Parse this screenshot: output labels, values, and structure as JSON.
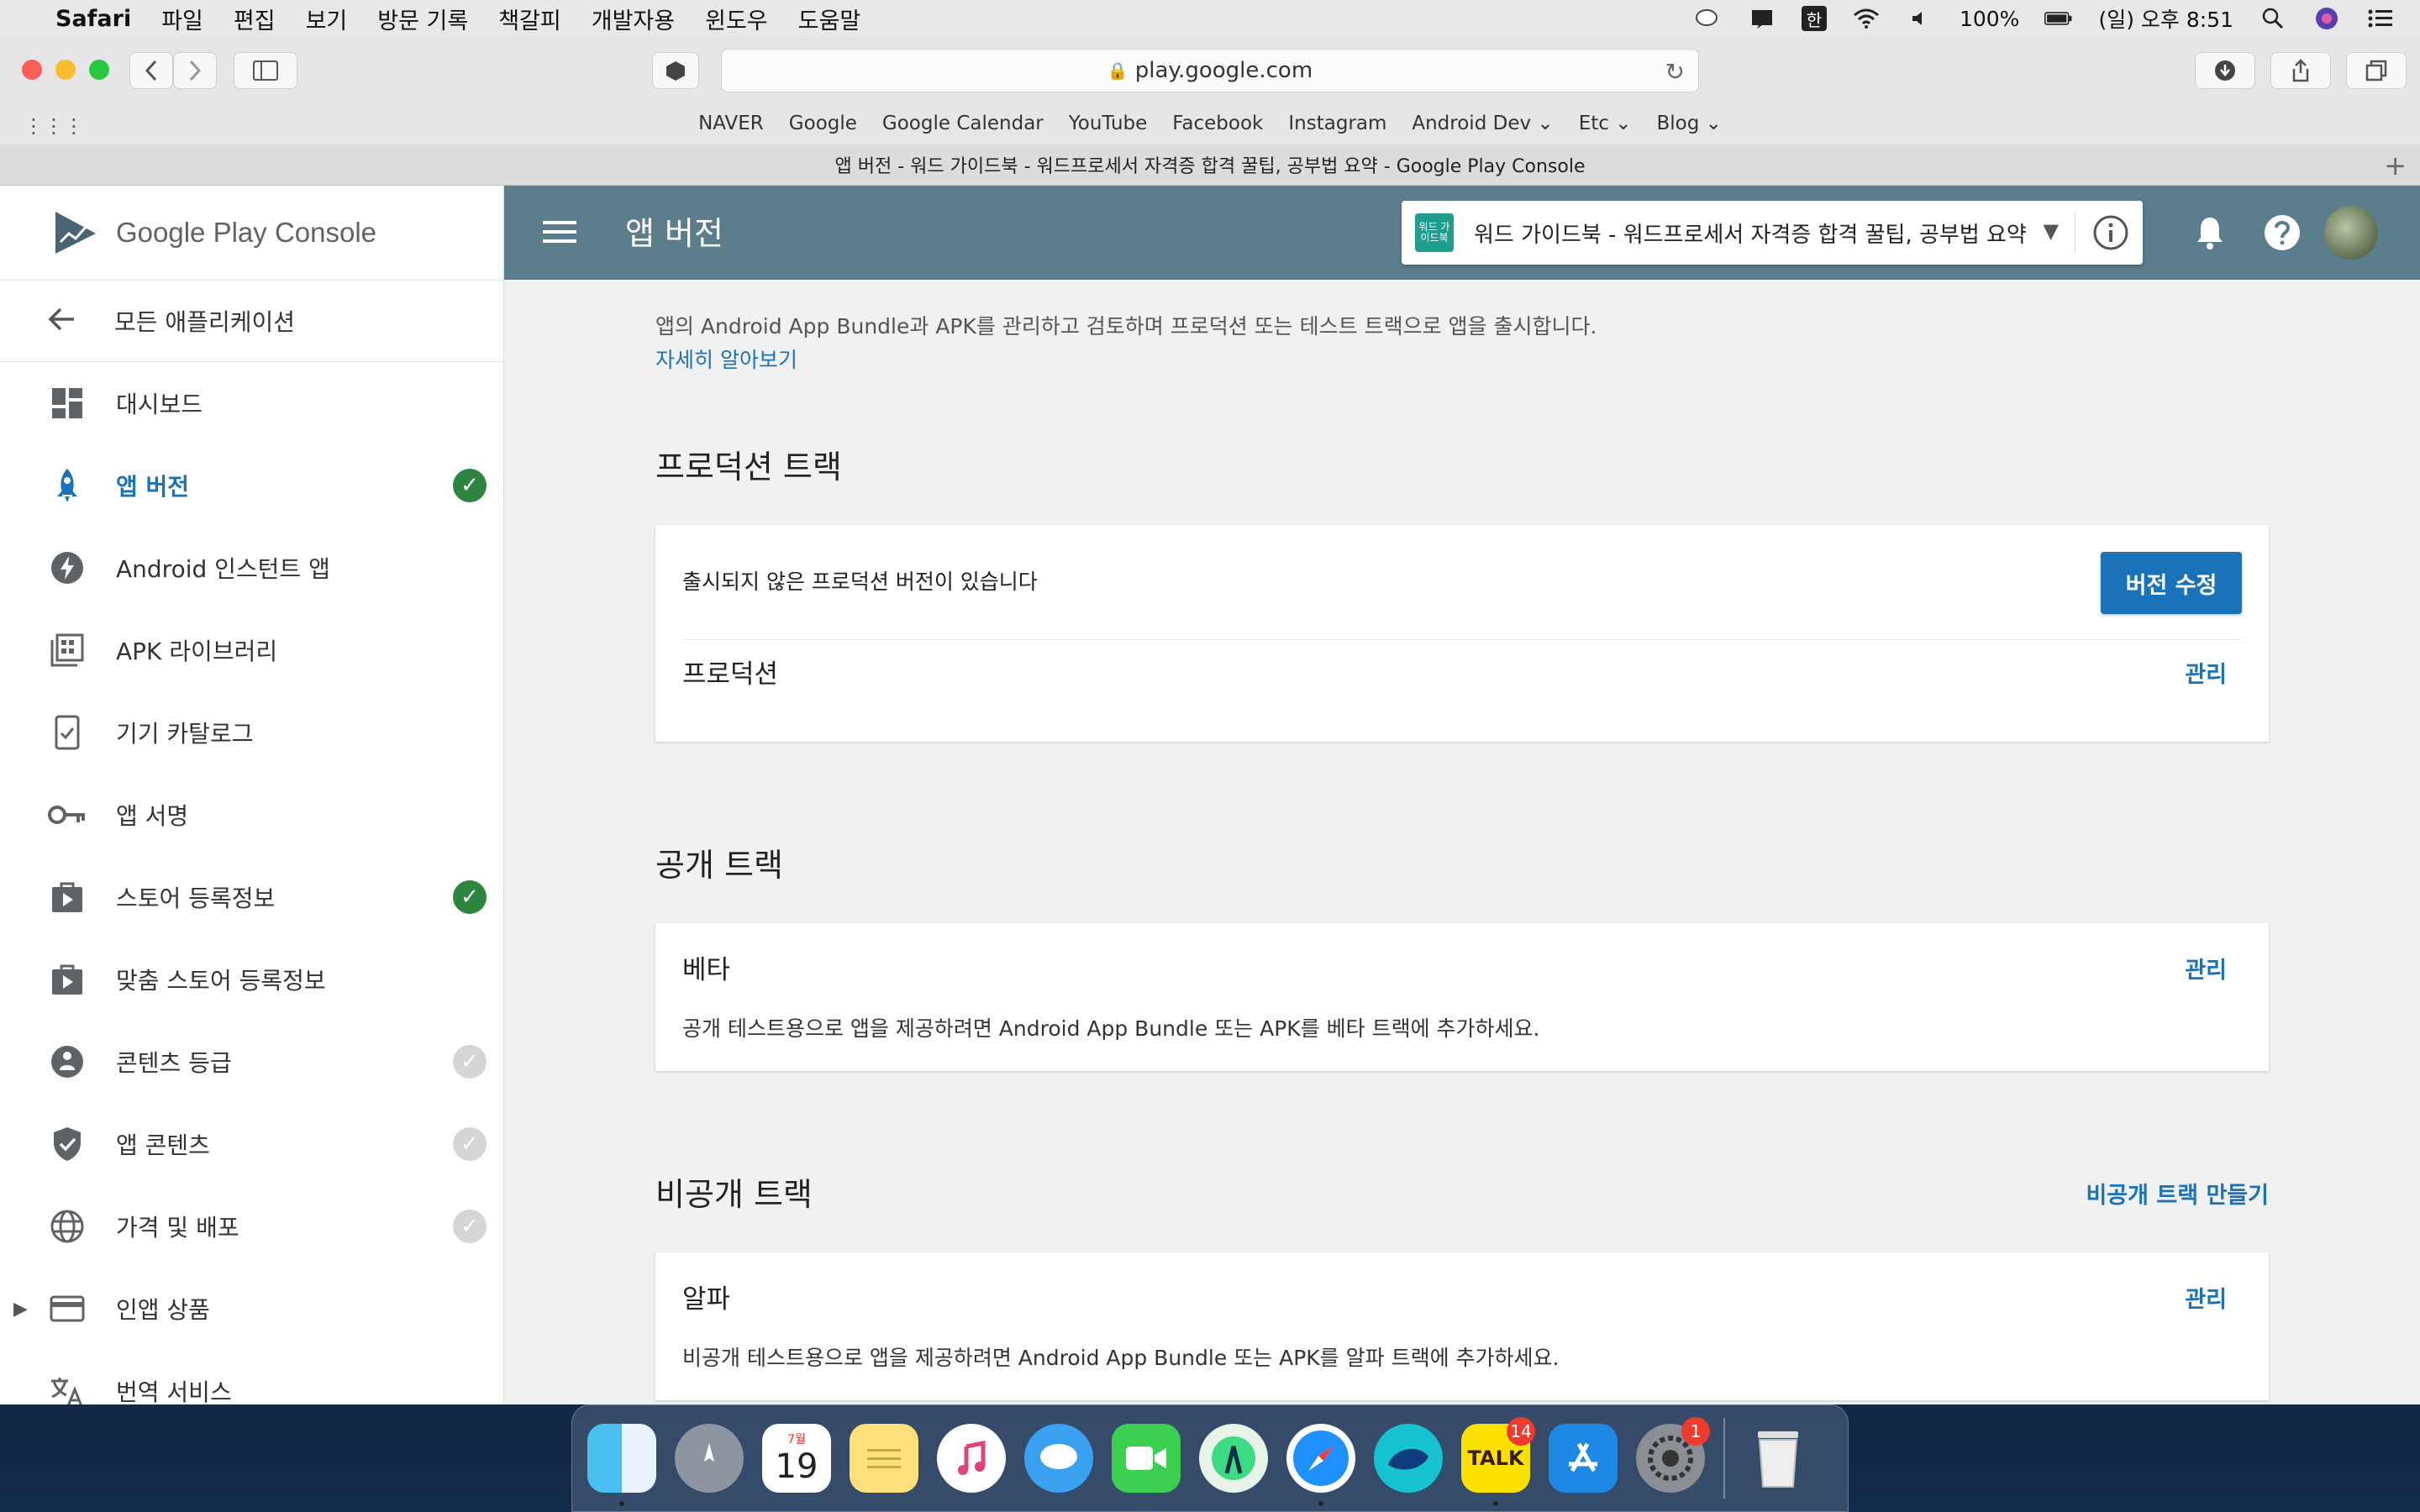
{
  "menubar": {
    "app": "Safari",
    "menus": [
      "파일",
      "편집",
      "보기",
      "방문 기록",
      "책갈피",
      "개발자용",
      "윈도우",
      "도움말"
    ],
    "battery": "100%",
    "clock": "(일) 오후 8:51",
    "input_method": "한"
  },
  "browser": {
    "url": "play.google.com",
    "favorites": [
      "NAVER",
      "Google",
      "Google Calendar",
      "YouTube",
      "Facebook",
      "Instagram",
      "Android Dev",
      "Etc",
      "Blog"
    ],
    "tab_title": "앱 버전 - 워드 가이드북 - 워드프로세서 자격증 합격 꿀팁, 공부법 요약 - Google Play Console"
  },
  "sidebar": {
    "logo_brand": "Google Play",
    "logo_suffix": "Console",
    "back_label": "모든 애플리케이션",
    "items": [
      {
        "label": "대시보드",
        "icon": "dashboard-icon",
        "status": "none"
      },
      {
        "label": "앱 버전",
        "icon": "rocket-icon",
        "status": "done"
      },
      {
        "label": "Android 인스턴트 앱",
        "icon": "bolt-icon",
        "status": "none"
      },
      {
        "label": "APK 라이브러리",
        "icon": "library-icon",
        "status": "none"
      },
      {
        "label": "기기 카탈로그",
        "icon": "device-icon",
        "status": "none"
      },
      {
        "label": "앱 서명",
        "icon": "key-icon",
        "status": "none"
      },
      {
        "label": "스토어 등록정보",
        "icon": "store-icon",
        "status": "done"
      },
      {
        "label": "맞춤 스토어 등록정보",
        "icon": "store-icon",
        "status": "none"
      },
      {
        "label": "콘텐츠 등급",
        "icon": "rating-icon",
        "status": "pending"
      },
      {
        "label": "앱 콘텐츠",
        "icon": "shield-icon",
        "status": "pending"
      },
      {
        "label": "가격 및 배포",
        "icon": "globe-icon",
        "status": "pending"
      },
      {
        "label": "인앱 상품",
        "icon": "card-icon",
        "status": "none"
      },
      {
        "label": "번역 서비스",
        "icon": "translate-icon",
        "status": "none"
      }
    ]
  },
  "header": {
    "title": "앱 버전",
    "app_name": "워드 가이드북 - 워드프로세서 자격증 합격 꿀팁, 공부법 요약",
    "app_icon_text": "워드 가이드북"
  },
  "main": {
    "intro": "앱의 Android App Bundle과 APK를 관리하고 검토하며 프로덕션 또는 테스트 트랙으로 앱을 출시합니다.",
    "learn_more": "자세히 알아보기",
    "production": {
      "title": "프로덕션 트랙",
      "notice": "출시되지 않은 프로덕션 버전이 있습니다",
      "edit_button": "버전 수정",
      "track_name": "프로덕션",
      "manage": "관리"
    },
    "open": {
      "title": "공개 트랙",
      "track_name": "베타",
      "manage": "관리",
      "desc": "공개 테스트용으로 앱을 제공하려면 Android App Bundle 또는 APK를 베타 트랙에 추가하세요."
    },
    "closed": {
      "title": "비공개 트랙",
      "create": "비공개 트랙 만들기",
      "track_name": "알파",
      "manage": "관리",
      "desc": "비공개 테스트용으로 앱을 제공하려면 Android App Bundle 또는 APK를 알파 트랙에 추가하세요."
    }
  },
  "dock": {
    "calendar_month": "7월",
    "calendar_day": "19",
    "kakao_label": "TALK",
    "kakao_badge": "14",
    "settings_badge": "1"
  },
  "colors": {
    "accent": "#1a73b8",
    "header": "#5b7d8c",
    "done": "#2e8540",
    "pending": "#d6d6d6"
  }
}
